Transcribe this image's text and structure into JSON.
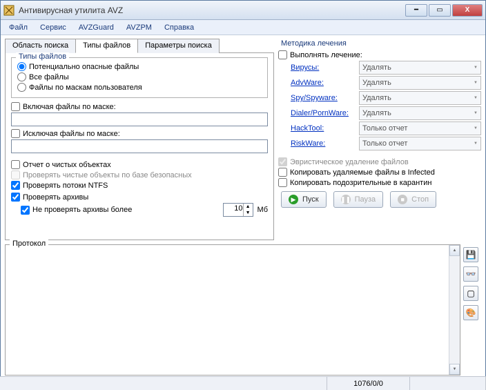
{
  "window": {
    "title": "Антивирусная утилита AVZ"
  },
  "menu": [
    "Файл",
    "Сервис",
    "AVZGuard",
    "AVZPM",
    "Справка"
  ],
  "tabs": {
    "items": [
      "Область поиска",
      "Типы файлов",
      "Параметры поиска"
    ],
    "active": 1
  },
  "fileTypes": {
    "legend": "Типы файлов",
    "options": [
      "Потенциально опасные файлы",
      "Все файлы",
      "Файлы по маскам пользователя"
    ],
    "selected": 0
  },
  "includeMask": {
    "label": "Включая файлы по маске:",
    "value": ""
  },
  "excludeMask": {
    "label": "Исключая файлы по маске:",
    "value": ""
  },
  "reportClean": {
    "label": "Отчет о чистых объектах",
    "checked": false
  },
  "checkCleanSafe": {
    "label": "Проверять чистые объекты по базе безопасных",
    "checked": false,
    "disabled": true
  },
  "checkNtfs": {
    "label": "Проверять потоки NTFS",
    "checked": true
  },
  "checkArchives": {
    "label": "Проверять архивы",
    "checked": true
  },
  "skipLarge": {
    "label": "Не проверять архивы более",
    "checked": true,
    "value": "10",
    "unit": "Мб"
  },
  "treatment": {
    "heading": "Методика лечения",
    "doTreat": {
      "label": "Выполнять лечение:",
      "checked": false
    },
    "rows": [
      {
        "name": "Вирусы:",
        "action": "Удалять"
      },
      {
        "name": "AdvWare:",
        "action": "Удалять"
      },
      {
        "name": "Spy/Spyware:",
        "action": "Удалять"
      },
      {
        "name": "Dialer/PornWare:",
        "action": "Удалять"
      },
      {
        "name": "HackTool:",
        "action": "Только отчет"
      },
      {
        "name": "RiskWare:",
        "action": "Только отчет"
      }
    ],
    "heurDelete": {
      "label": "Эвристическое удаление файлов",
      "checked": true,
      "disabled": true
    },
    "copyInfected": {
      "label": "Копировать удаляемые файлы в  Infected",
      "checked": false
    },
    "copyQuarantine": {
      "label": "Копировать подозрительные в  карантин",
      "checked": false
    }
  },
  "actions": {
    "start": "Пуск",
    "pause": "Пауза",
    "stop": "Стоп"
  },
  "protocol": {
    "label": "Протокол"
  },
  "status": {
    "counts": "1076/0/0"
  },
  "sideIcons": [
    "save-icon",
    "glasses-icon",
    "page-icon",
    "palette-icon"
  ]
}
